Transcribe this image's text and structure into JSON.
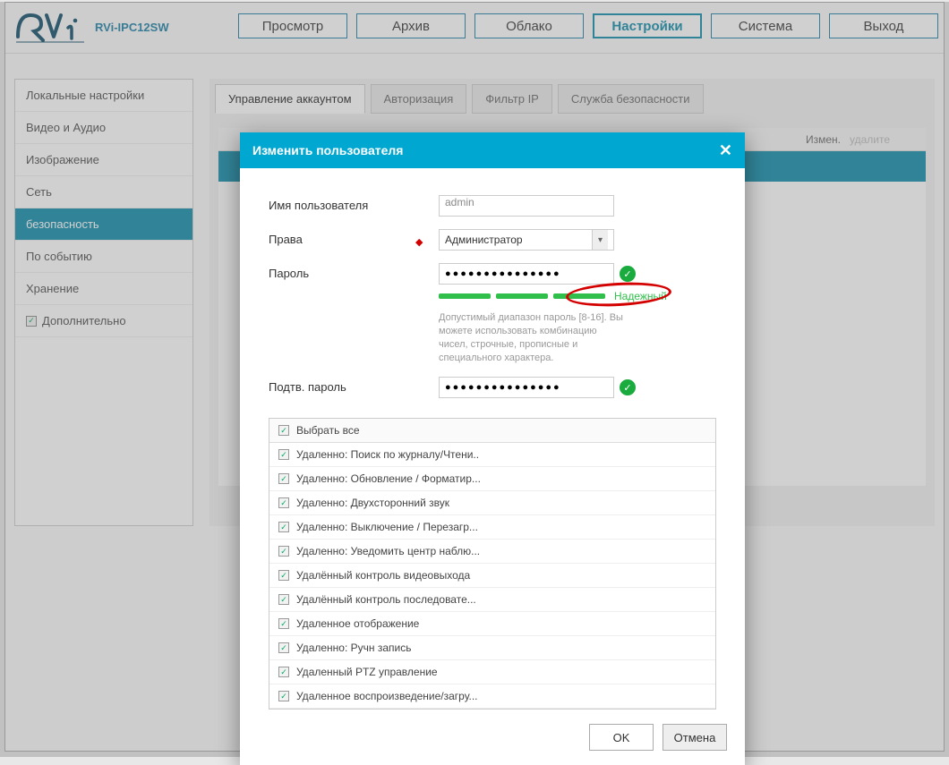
{
  "header": {
    "model": "RVi-IPC12SW",
    "tabs": [
      "Просмотр",
      "Архив",
      "Облако",
      "Настройки",
      "Система",
      "Выход"
    ],
    "active_tab_index": 3
  },
  "sidebar": {
    "items": [
      {
        "label": "Локальные настройки"
      },
      {
        "label": "Видео и Аудио"
      },
      {
        "label": "Изображение"
      },
      {
        "label": "Сеть"
      },
      {
        "label": "безопасность",
        "active": true
      },
      {
        "label": "По событию"
      },
      {
        "label": "Хранение"
      },
      {
        "label": "Дополнительно",
        "checkbox": true
      }
    ]
  },
  "content": {
    "subtabs": [
      "Управление аккаунтом",
      "Авторизация",
      "Фильтр IP",
      "Служба безопасности"
    ],
    "active_subtab_index": 0,
    "table_header_left": "Измен.",
    "table_header_right": "удалите"
  },
  "modal": {
    "title": "Изменить пользователя",
    "labels": {
      "username": "Имя пользователя",
      "rights": "Права",
      "password": "Пароль",
      "confirm": "Подтв. пароль"
    },
    "values": {
      "username": "admin",
      "rights": "Администратор",
      "password_mask": "●●●●●●●●●●●●●●●",
      "confirm_mask": "●●●●●●●●●●●●●●●"
    },
    "strength_label": "Надежный",
    "hint": "Допустимый диапазон пароль [8-16]. Вы можете использовать комбинацию чисел, строчные, прописные и специального характера.",
    "select_all": "Выбрать все",
    "permissions": [
      "Удаленно: Поиск по журналу/Чтени..",
      "Удаленно: Обновление / Форматир...",
      "Удаленно: Двухсторонний звук",
      "Удаленно: Выключение / Перезагр...",
      "Удаленно: Уведомить центр наблю...",
      "Удалённый контроль видеовыхода",
      "Удалённый контроль последовате...",
      "Удаленное отображение",
      "Удаленно: Ручн запись",
      "Удаленный PTZ управление",
      "Удаленное воспроизведение/загру..."
    ],
    "ok": "OK",
    "cancel": "Отмена"
  }
}
